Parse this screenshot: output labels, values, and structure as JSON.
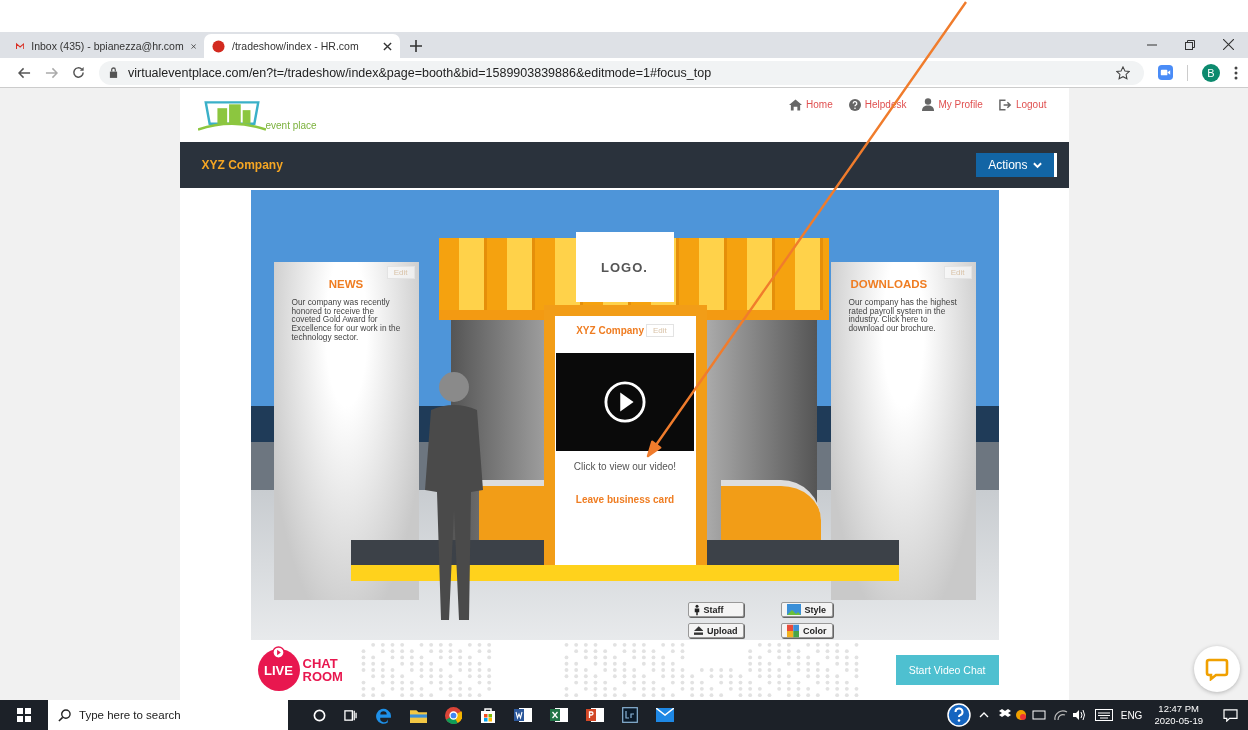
{
  "browser": {
    "tabs": [
      {
        "title": "Inbox (435) - bpianezza@hr.com",
        "selected": false
      },
      {
        "title": "/tradeshow/index - HR.com",
        "selected": true
      }
    ],
    "url": "virtualeventplace.com/en?t=/tradeshow/index&page=booth&bid=1589903839886&editmode=1#focus_top",
    "profile_initial": "B"
  },
  "site": {
    "logo_text": "event place",
    "nav": [
      {
        "label": "Home"
      },
      {
        "label": "Helpdesk"
      },
      {
        "label": "My Profile"
      },
      {
        "label": "Logout"
      }
    ]
  },
  "booth_bar": {
    "title": "XYZ Company",
    "actions_label": "Actions"
  },
  "booth": {
    "logo_text": "LOGO.",
    "left_panel": {
      "title": "NEWS",
      "text": "Our company was recently honored to receive the coveted Gold Award for Excellence for our work in the technology sector.",
      "edit": "Edit"
    },
    "right_panel": {
      "title": "DOWNLOADS",
      "text": "Our company has the highest rated payroll system in the industry. Click here to download our brochure.",
      "edit": "Edit"
    },
    "center": {
      "title": "XYZ Company",
      "edit": "Edit",
      "video_caption": "Click to view our video!",
      "card_link": "Leave business card"
    },
    "edit_tools": [
      {
        "label": "Staff",
        "kind": "staff"
      },
      {
        "label": "Style",
        "kind": "style"
      },
      {
        "label": "Upload",
        "kind": "upload"
      },
      {
        "label": "Color",
        "kind": "color"
      }
    ]
  },
  "footer": {
    "live": "LIVE",
    "chat": "CHAT",
    "room": "ROOM",
    "video_chat_button": "Start Video Chat"
  },
  "taskbar": {
    "search_placeholder": "Type here to search",
    "language": "ENG",
    "time": "12:47 PM",
    "date": "2020-05-19"
  }
}
